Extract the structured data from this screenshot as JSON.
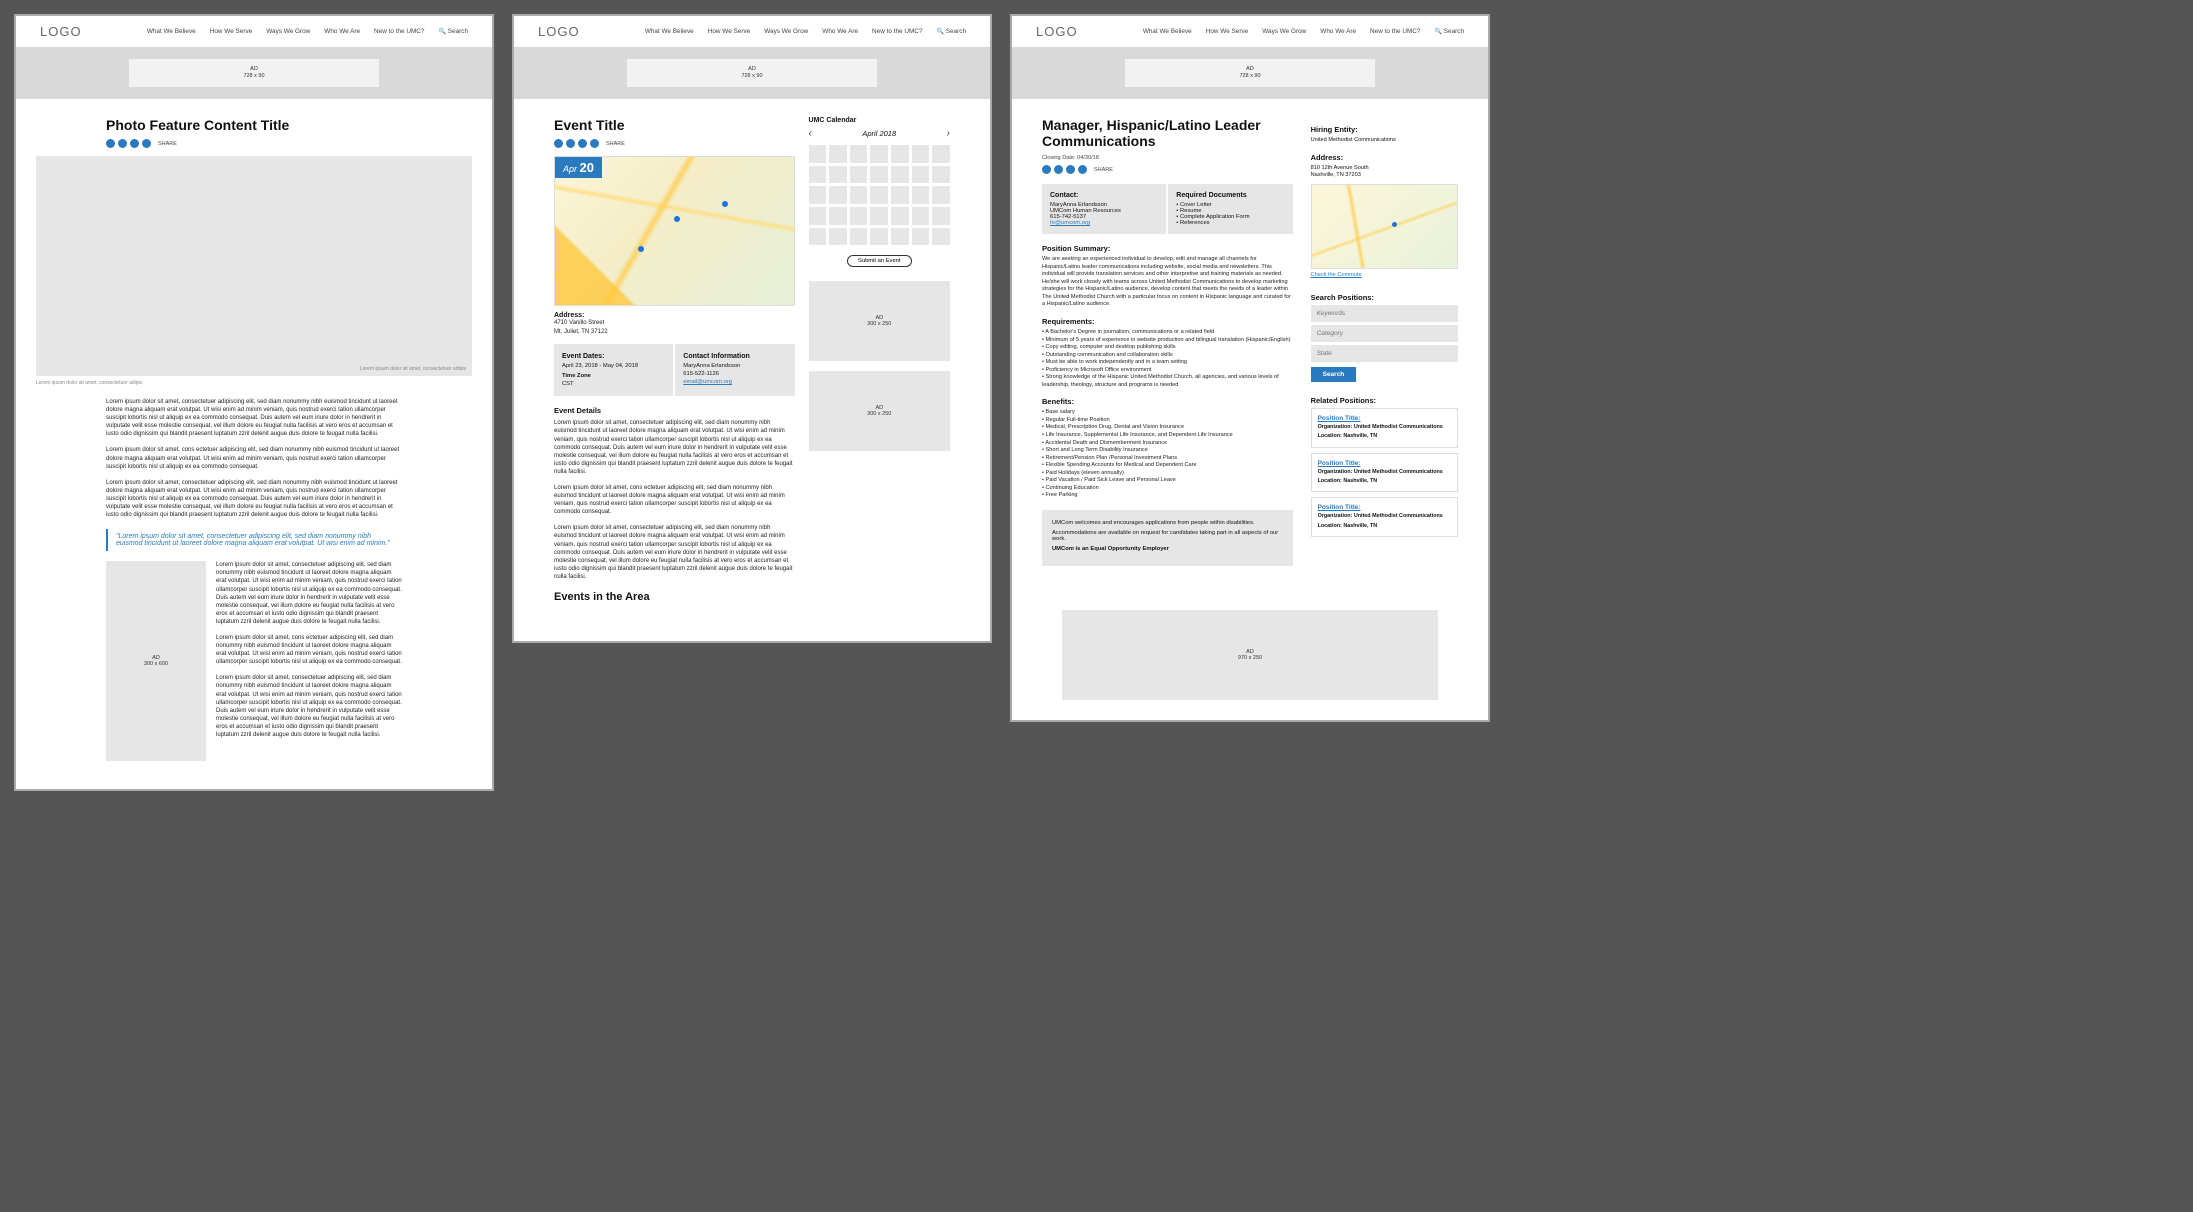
{
  "nav": {
    "logo": "LOGO",
    "items": [
      "What We Believe",
      "How We Serve",
      "Ways We Grow",
      "Who We Are",
      "New to the UMC?"
    ],
    "search": "Search"
  },
  "ads": {
    "banner_label": "AD",
    "banner_size": "728 x 90",
    "side300_label": "AD",
    "side300_size": "300 x 250",
    "side600_label": "AD",
    "side600_size": "300 x 600",
    "big_label": "AD",
    "big_size": "970 x 250"
  },
  "share": {
    "label": "SHARE"
  },
  "photo": {
    "title": "Photo Feature Content Title",
    "caption_in": "Lorem ipsum dolor sit amet, consectetuer adipis",
    "caption_out": "Lorem ipsum dolor sit amet, consectetuer adipis",
    "p1": "Lorem ipsum dolor sit amet, consectetuer adipiscing elit, sed diam nonummy nibh euismod tincidunt ut laoreet dolore magna aliquam erat volutpat. Ut wisi enim ad minim veniam, quis nostrud exerci tation ullamcorper suscipit lobortis nisl ut aliquip ex ea commodo consequat. Duis autem vel eum iriure dolor in hendrerit in vulputate velit esse molestie consequat, vel illum dolore eu feugiat nulla facilisis at vero eros et accumsan et iusto odio dignissim qui blandit praesent luptatum zzril delenit augue duis dolore te feugait nulla facilisi.",
    "p2": "Lorem ipsum dolor sit amet, cons ectetuer adipiscing elit, sed diam nonummy nibh euismod tincidunt ut laoreet dolore magna aliquam erat volutpat. Ut wisi enim ad minim veniam, quis nostrud exerci tation ullamcorper suscipit lobortis nisl ut aliquip ex ea commodo consequat.",
    "p3": "Lorem ipsum dolor sit amet, consectetuer adipiscing elit, sed diam nonummy nibh euismod tincidunt ut laoreet dolore magna aliquam erat volutpat. Ut wisi enim ad minim veniam, quis nostrud exerci tation ullamcorper suscipit lobortis nisl ut aliquip ex ea commodo consequat. Duis autem vel eum iriure dolor in hendrerit in vulputate velit esse molestie consequat, vel illum dolore eu feugiat nulla facilisis at vero eros et accumsan et iusto odio dignissim qui blandit praesent luptatum zzril delenit augue duis dolore te feugait nulla facilisi.",
    "quote": "\"Lorem ipsum dolor sit amet, consectetuer adipiscing elit, sed diam nonummy nibh euismod tincidunt ut laoreet dolore magna aliquam erat volutpat. Ut wisi enim ad minim.\"",
    "p4": "Lorem ipsum dolor sit amet, consectetuer adipiscing elit, sed diam nonummy nibh euismod tincidunt ut laoreet dolore magna aliquam erat volutpat. Ut wisi enim ad minim veniam, quis nostrud exerci tation ullamcorper suscipit lobortis nisl ut aliquip ex ea commodo consequat. Duis autem vel eum iriure dolor in hendrerit in vulputate velit esse molestie consequat, vel illum dolore eu feugiat nulla facilisis at vero eros et accumsan et iusto odio dignissim qui blandit praesent luptatum zzril delenit augue duis dolore te feugait nulla facilisi.",
    "p5": "Lorem ipsum dolor sit amet, cons ectetuer adipiscing elit, sed diam nonummy nibh euismod tincidunt ut laoreet dolore magna aliquam erat volutpat. Ut wisi enim ad minim veniam, quis nostrud exerci tation ullamcorper suscipit lobortis nisl ut aliquip ex ea commodo consequat.",
    "p6": "Lorem ipsum dolor sit amet, consectetuer adipiscing elit, sed diam nonummy nibh euismod tincidunt ut laoreet dolore magna aliquam erat volutpat. Ut wisi enim ad minim veniam, quis nostrud exerci tation ullamcorper suscipit lobortis nisl ut aliquip ex ea commodo consequat. Duis autem vel eum iriure dolor in hendrerit in vulputate velit esse molestie consequat, vel illum dolore eu feugiat nulla facilisis at vero eros et accumsan et iusto odio dignissim qui blandit praesent luptatum zzril delenit augue duis dolore te feugait nulla facilisi."
  },
  "event": {
    "title": "Event Title",
    "badge_month": "Apr",
    "badge_day": "20",
    "address_h": "Address:",
    "address1": "4710 Vanillo Street",
    "address2": "Mt. Juliet, TN 37122",
    "dates_h": "Event Dates:",
    "dates": "April 23, 2018 - May 04, 2018",
    "tz_h": "Time Zone",
    "tz": "CST",
    "contact_h": "Contact Information",
    "contact_name": "MaryAnna Erlandsson",
    "contact_phone": "615-522-1126",
    "contact_email": "email@umcom.org",
    "details_h": "Event Details",
    "details_p1": "Lorem ipsum dolor sit amet, consectetuer adipiscing elit, sed diam nonummy nibh euismod tincidunt ut laoreet dolore magna aliquam erat volutpat. Ut wisi enim ad minim veniam, quis nostrud exerci tation ullamcorper suscipit lobortis nisl ut aliquip ex ea commodo consequat. Duis autem vel eum iriure dolor in hendrerit in vulputate velit esse molestie consequat, vel illum dolore eu feugiat nulla facilisis at vero eros et accumsan et iusto odio dignissim qui blandit praesent luptatum zzril delenit augue duis dolore te feugait nulla facilisi.",
    "details_p2": "Lorem ipsum dolor sit amet, cons ectetuer adipiscing elit, sed diam nonummy nibh euismod tincidunt ut laoreet dolore magna aliquam erat volutpat. Ut wisi enim ad minim veniam, quis nostrud exerci tation ullamcorper suscipit lobortis nisl ut aliquip ex ea commodo consequat.",
    "details_p3": "Lorem ipsum dolor sit amet, consectetuer adipiscing elit, sed diam nonummy nibh euismod tincidunt ut laoreet dolore magna aliquam erat volutpat. Ut wisi enim ad minim veniam, quis nostrud exerci tation ullamcorper suscipit lobortis nisl ut aliquip ex ea commodo consequat. Duis autem vel eum iriure dolor in hendrerit in vulputate velit esse molestie consequat, vel illum dolore eu feugiat nulla facilisis at vero eros et accumsan et iusto odio dignissim qui blandit praesent luptatum zzril delenit augue duis dolore te feugait nulla facilisi.",
    "area_h": "Events in the Area",
    "cal_title": "UMC Calendar",
    "cal_month": "April 2018",
    "submit": "Submit an Event"
  },
  "job": {
    "title": "Manager, Hispanic/Latino Leader Communications",
    "closing": "Closing Date: 04/30/18",
    "contact_h": "Contact:",
    "contact_name": "MaryAnna Erlandsson",
    "contact_org": "UMCom Human Resources",
    "contact_phone": "615-742-5137",
    "contact_email": "hr@umcom.org",
    "docs_h": "Required Documents",
    "docs": [
      "Cover Letter",
      "Resume",
      "Complete Application Form",
      "References"
    ],
    "summary_h": "Position Summary:",
    "summary": "We are seeking an experienced individual to develop, edit and manage all channels for Hispanic/Latino leader communications including website, social media and newsletters. This individual will provide translation services and other interpretive and training materials as needed. He/she will work closely with teams across United Methodist Communications to develop marketing strategies for the Hispanic/Latino audience, develop content that meets the needs of a leader within The United Methodist Church with a particular focus on content in Hispanic language and curated for a Hispanic/Latino audience.",
    "req_h": "Requirements:",
    "reqs": [
      "A Bachelor's Degree in journalism, communications or a related field",
      "Minimum of 5 years of experience in website production and bilingual translation (Hispanic/English)",
      "Copy editing, computer and desktop publishing skills",
      "Outstanding communication and collaboration skills",
      "Must be able to work independently and in a team setting",
      "Proficiency in Microsoft Office environment",
      "Strong knowledge of the Hispanic United Methodist Church, all agencies, and various levels of leadership, theology, structure and programs is needed"
    ],
    "ben_h": "Benefits:",
    "bens": [
      "Base salary",
      "Regular Full-time Position",
      "Medical, Prescription Drug, Dental and Vision Insurance",
      "Life Insurance, Supplemental Life Insurance, and Dependent Life Insurance",
      "Accidental Death and Dismemberment Insurance",
      "Short and Long Term Disability Insurance",
      "Retirement/Pension Plan /Personal Investment Plans",
      "Flexible Spending Accounts for Medical and Dependent Care",
      "Paid Holidays (eleven annually)",
      "Paid Vacation / Paid Sick Leave and Personal Leave",
      "Continuing Education",
      "Free Parking"
    ],
    "eoe1": "UMCom welcomes and encourages applications from people within disabilities.",
    "eoe2": "Accommodations are available on request for candidates taking part in all aspects of our work.",
    "eoe3": "UMCom is an Equal Opportunity Employer",
    "hiring_h": "Hiring Entity:",
    "hiring": "United Methodist Communications",
    "addr_h": "Address:",
    "addr1": "810 12th Avenue South",
    "addr2": "Nashville, TN 37203",
    "commute": "Check the Commute",
    "search_h": "Search Positions:",
    "ph_kw": "Keywords",
    "ph_cat": "Category",
    "ph_state": "State",
    "search_btn": "Search",
    "related_h": "Related Positions:",
    "rel_title": "Position Title:",
    "rel_org": "Organization: United Methodist Communications",
    "rel_loc": "Location: Nashville, TN"
  }
}
